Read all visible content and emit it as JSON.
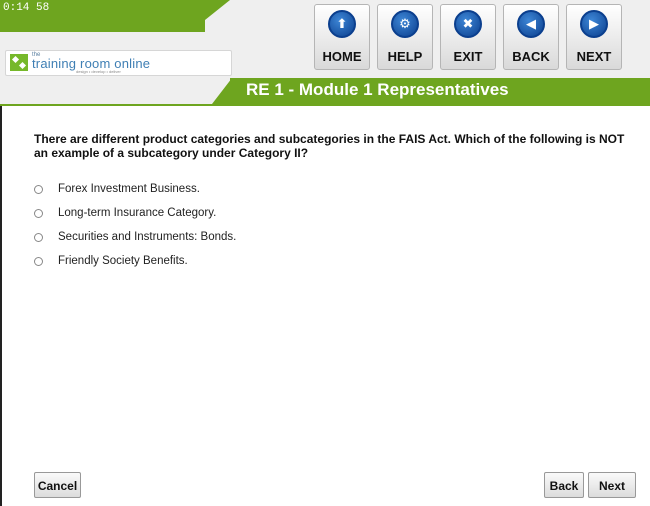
{
  "header": {
    "timer": "0:14 58",
    "logo": {
      "small": "the",
      "name": "training room online",
      "tagline": "design • develop • deliver"
    },
    "title": "RE 1 - Module 1 Representatives",
    "nav": [
      {
        "label": "HOME",
        "icon": "home-icon",
        "glyph": "⬆"
      },
      {
        "label": "HELP",
        "icon": "help-icon",
        "glyph": "⚙"
      },
      {
        "label": "EXIT",
        "icon": "exit-icon",
        "glyph": "✖"
      },
      {
        "label": "BACK",
        "icon": "back-icon",
        "glyph": "◀"
      },
      {
        "label": "NEXT",
        "icon": "next-icon",
        "glyph": "▶"
      }
    ]
  },
  "question": {
    "text": "There are different product categories and subcategories in the FAIS Act.  Which of the following is NOT an example of a subcategory under Category II?",
    "options": [
      "Forex Investment Business.",
      "Long-term Insurance Category.",
      "Securities and Instruments: Bonds.",
      "Friendly Society Benefits."
    ]
  },
  "buttons": {
    "cancel": "Cancel",
    "back": "Back",
    "next": "Next"
  },
  "colors": {
    "brand_green": "#6ea51f",
    "nav_blue": "#0b3f8e"
  }
}
